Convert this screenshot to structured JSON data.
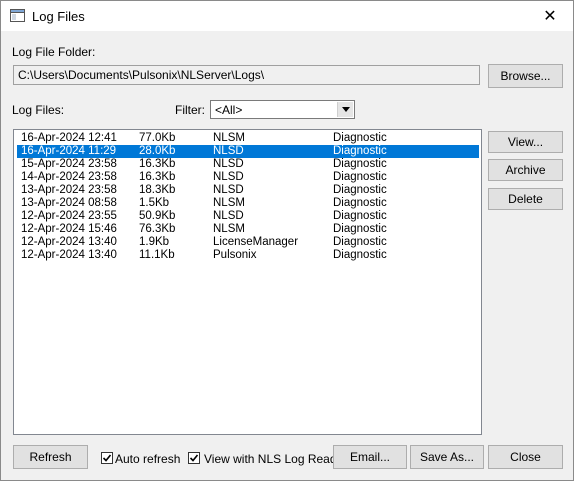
{
  "window": {
    "title": "Log Files",
    "close_glyph": "✕"
  },
  "folder": {
    "label": "Log File Folder:",
    "path": "C:\\Users\\Documents\\Pulsonix\\NLServer\\Logs\\",
    "browse_label": "Browse..."
  },
  "files": {
    "label": "Log Files:",
    "filter_label": "Filter:",
    "filter_value": "<All>",
    "rows": [
      {
        "date": "16-Apr-2024 12:41",
        "size": "77.0Kb",
        "source": "NLSM",
        "type": "Diagnostic"
      },
      {
        "date": "16-Apr-2024 11:29",
        "size": "28.0Kb",
        "source": "NLSD",
        "type": "Diagnostic"
      },
      {
        "date": "15-Apr-2024 23:58",
        "size": "16.3Kb",
        "source": "NLSD",
        "type": "Diagnostic"
      },
      {
        "date": "14-Apr-2024 23:58",
        "size": "16.3Kb",
        "source": "NLSD",
        "type": "Diagnostic"
      },
      {
        "date": "13-Apr-2024 23:58",
        "size": "18.3Kb",
        "source": "NLSD",
        "type": "Diagnostic"
      },
      {
        "date": "13-Apr-2024 08:58",
        "size": "1.5Kb",
        "source": "NLSM",
        "type": "Diagnostic"
      },
      {
        "date": "12-Apr-2024 23:55",
        "size": "50.9Kb",
        "source": "NLSD",
        "type": "Diagnostic"
      },
      {
        "date": "12-Apr-2024 15:46",
        "size": "76.3Kb",
        "source": "NLSM",
        "type": "Diagnostic"
      },
      {
        "date": "12-Apr-2024 13:40",
        "size": "1.9Kb",
        "source": "LicenseManager",
        "type": "Diagnostic"
      },
      {
        "date": "12-Apr-2024 13:40",
        "size": "11.1Kb",
        "source": "Pulsonix",
        "type": "Diagnostic"
      }
    ],
    "selected_index": 1
  },
  "side_buttons": {
    "view": "View...",
    "archive": "Archive",
    "delete": "Delete"
  },
  "bottom": {
    "refresh": "Refresh",
    "auto_refresh": "Auto refresh",
    "view_with_reader": "View with NLS Log Reader",
    "email": "Email...",
    "save_as": "Save As...",
    "close": "Close"
  },
  "colors": {
    "selection": "#0078d7"
  },
  "icons": {
    "window": "log-window-icon",
    "close": "close-icon",
    "dropdown": "chevron-down-icon",
    "check": "check-icon"
  }
}
